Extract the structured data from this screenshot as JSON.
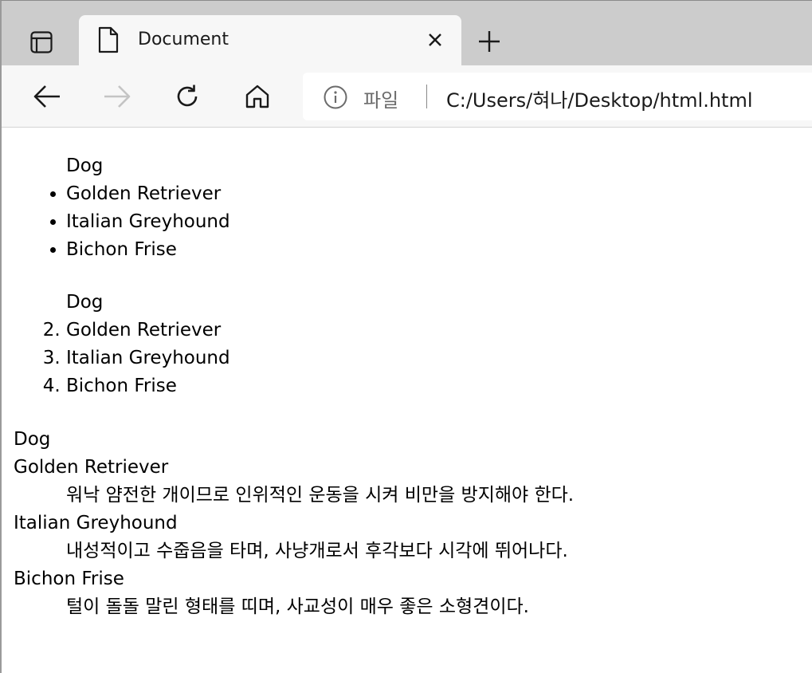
{
  "browser": {
    "tab": {
      "title": "Document"
    },
    "address_bar": {
      "file_label": "파일",
      "url": "C:/Users/혀나/Desktop/html.html"
    }
  },
  "icons": {
    "tab_actions": "tab-actions-icon",
    "document": "document-icon",
    "close": "close-icon",
    "new_tab": "plus-icon",
    "back": "back-arrow-icon",
    "forward": "forward-arrow-icon",
    "refresh": "refresh-icon",
    "home": "home-icon",
    "info": "info-icon"
  },
  "page": {
    "unordered": {
      "header": "Dog",
      "items": [
        "Golden Retriever",
        "Italian Greyhound",
        "Bichon Frise"
      ]
    },
    "ordered": {
      "header": "Dog",
      "items": [
        "Golden Retriever",
        "Italian Greyhound",
        "Bichon Frise"
      ]
    },
    "definitions": {
      "title": "Dog",
      "entries": [
        {
          "term": "Golden Retriever",
          "desc": "워낙 얌전한 개이므로 인위적인 운동을 시켜 비만을 방지해야 한다."
        },
        {
          "term": "Italian Greyhound",
          "desc": "내성적이고 수줍음을 타며, 사냥개로서 후각보다 시각에 뛰어나다."
        },
        {
          "term": "Bichon Frise",
          "desc": "털이 돌돌 말린 형태를 띠며, 사교성이 매우 좋은 소형견이다."
        }
      ]
    }
  }
}
